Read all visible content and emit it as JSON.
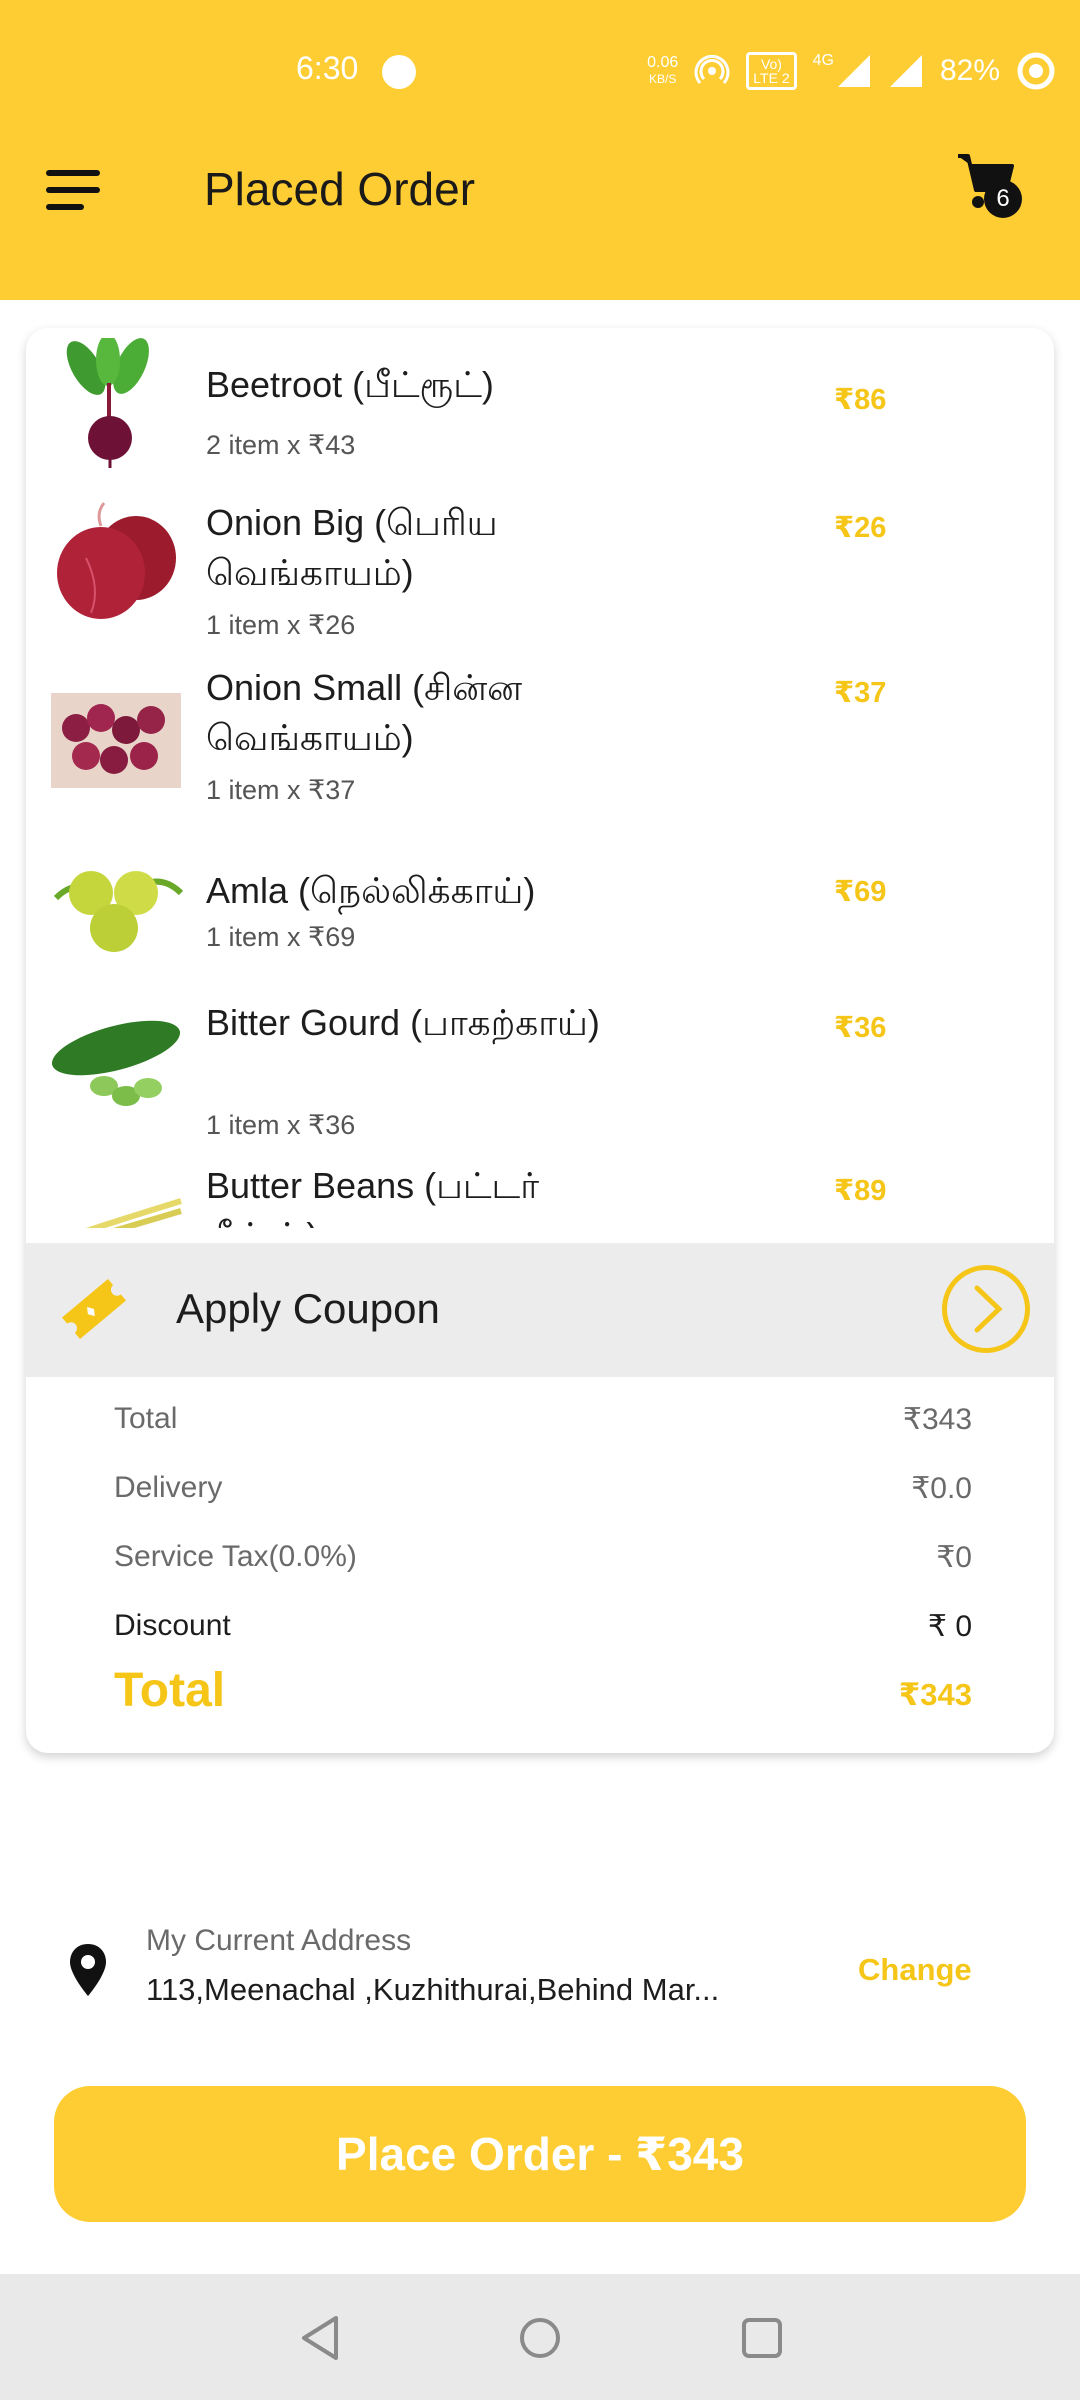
{
  "status_bar": {
    "time": "6:30",
    "net_speed_value": "0.06",
    "net_speed_unit": "KB/S",
    "volte_line1": "Vo)",
    "volte_line2": "LTE 2",
    "network": "4G",
    "battery": "82%"
  },
  "header": {
    "title": "Placed Order",
    "cart_count": "6",
    "bg_color": "#FECD33"
  },
  "items": [
    {
      "name": "Beetroot (பீட்ரூட்)",
      "qty": "2 item x ₹43",
      "price": "₹86",
      "icon": "beetroot-image"
    },
    {
      "name": "Onion Big (பெரிய வெங்காயம்)",
      "qty": "1 item x ₹26",
      "price": "₹26",
      "icon": "onion-big-image"
    },
    {
      "name": "Onion Small (சின்ன வெங்காயம்)",
      "qty": "1 item x ₹37",
      "price": "₹37",
      "icon": "onion-small-image"
    },
    {
      "name": " Amla (நெல்லிக்காய்)",
      "qty": "1 item x ₹69",
      "price": "₹69",
      "icon": "amla-image"
    },
    {
      "name": "Bitter Gourd (பாகற்காய்)",
      "qty": "1 item x ₹36",
      "price": "₹36",
      "icon": "bitter-gourd-image"
    },
    {
      "name": "Butter Beans (பட்டர் பீன்ஸ்)",
      "qty": "",
      "price": "₹89",
      "icon": "butter-beans-image"
    }
  ],
  "coupon": {
    "label": "Apply Coupon",
    "icon": "coupon-ticket-icon"
  },
  "summary": {
    "total_label": "Total",
    "total_value": "₹343",
    "delivery_label": "Delivery",
    "delivery_value": "₹0.0",
    "tax_label": "Service Tax(0.0%)",
    "tax_value": "₹0",
    "discount_label": "Discount",
    "discount_value": "₹ 0",
    "grand_label": "Total",
    "grand_value": "₹343"
  },
  "address": {
    "label": "My Current Address",
    "text": "113,Meenachal ,Kuzhithurai,Behind Mar...",
    "change_label": "Change"
  },
  "place_order": {
    "label": "Place Order - ₹343"
  },
  "accent_color": "#F5C518"
}
